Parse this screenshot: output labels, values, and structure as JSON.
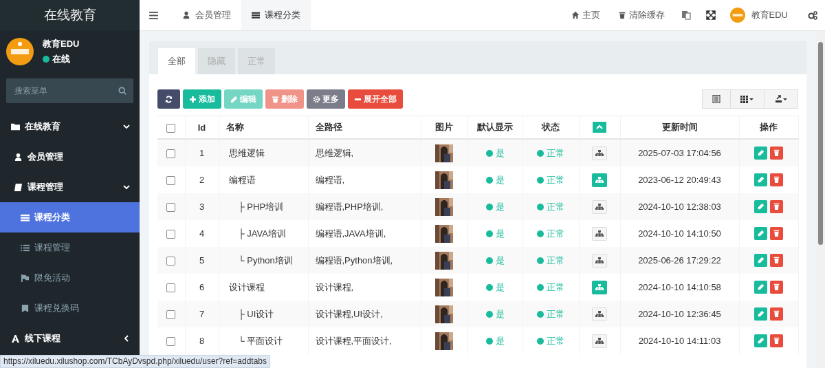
{
  "sidebar": {
    "title": "在线教育",
    "user": {
      "name": "教育EDU",
      "status": "在线"
    },
    "search": {
      "placeholder": "搜索菜单"
    },
    "items": [
      {
        "label": "在线教育",
        "expanded": true,
        "selected": false,
        "children": [
          {
            "label": "会员管理",
            "selected": false
          },
          {
            "label": "课程管理",
            "expanded": true,
            "selected": false,
            "children": [
              {
                "label": "课程分类",
                "selected": true
              },
              {
                "label": "课程管理",
                "selected": false
              },
              {
                "label": "限免活动",
                "selected": false
              },
              {
                "label": "课程兑换码",
                "selected": false
              }
            ]
          }
        ]
      },
      {
        "label": "线下课程",
        "expanded": false,
        "selected": false
      }
    ]
  },
  "topbar": {
    "tabs": [
      {
        "label": "会员管理",
        "selected": false
      },
      {
        "label": "课程分类",
        "selected": true
      }
    ],
    "links": [
      "主页",
      "清除缓存"
    ],
    "user": "教育EDU"
  },
  "tabs": [
    {
      "label": "全部",
      "selected": true
    },
    {
      "label": "隐藏",
      "selected": false
    },
    {
      "label": "正常",
      "selected": false
    }
  ],
  "toolbar": [
    {
      "kind": "refresh",
      "disabled": false
    },
    {
      "kind": "add",
      "label": "添加",
      "disabled": false
    },
    {
      "kind": "edit",
      "label": "编辑",
      "disabled": true
    },
    {
      "kind": "delete",
      "label": "删除",
      "disabled": true
    },
    {
      "kind": "more",
      "label": "更多",
      "disabled": false
    },
    {
      "kind": "expand",
      "label": "展开全部",
      "disabled": false
    }
  ],
  "table": {
    "all_checked": false,
    "columns": [
      "Id",
      "名称",
      "全路径",
      "图片",
      "默认显示",
      "状态",
      "更新时间",
      "操作"
    ],
    "rows": [
      {
        "id": "1",
        "name": "思维逻辑",
        "path": "思维逻辑,",
        "default_display": "是",
        "status": "正常",
        "updated": "2025-07-03 17:04:56",
        "checked": false
      },
      {
        "id": "2",
        "name": "编程语",
        "path": "编程语,",
        "default_display": "是",
        "status": "正常",
        "updated": "2023-06-12 20:49:43",
        "checked": false,
        "children": [
          {
            "id": "3",
            "name": "├ PHP培训",
            "path": "编程语,PHP培训,",
            "default_display": "是",
            "status": "正常",
            "updated": "2024-10-10 12:38:03",
            "checked": false
          },
          {
            "id": "4",
            "name": "├ JAVA培训",
            "path": "编程语,JAVA培训,",
            "default_display": "是",
            "status": "正常",
            "updated": "2024-10-10 14:10:50",
            "checked": false
          },
          {
            "id": "5",
            "name": "└ Python培训",
            "path": "编程语,Python培训,",
            "default_display": "是",
            "status": "正常",
            "updated": "2025-06-26 17:29:22",
            "checked": false
          }
        ]
      },
      {
        "id": "6",
        "name": "设计课程",
        "path": "设计课程,",
        "default_display": "是",
        "status": "正常",
        "updated": "2024-10-10 14:10:58",
        "checked": false,
        "children": [
          {
            "id": "7",
            "name": "├ UI设计",
            "path": "设计课程,UI设计,",
            "default_display": "是",
            "status": "正常",
            "updated": "2024-10-10 12:36:45",
            "checked": false
          },
          {
            "id": "8",
            "name": "└ 平面设计",
            "path": "设计课程,平面设计,",
            "default_display": "是",
            "status": "正常",
            "updated": "2024-10-10 14:11:03",
            "checked": false
          }
        ]
      }
    ]
  },
  "status_url": "https://xiluedu.xilushop.com/TCbAyDvspd.php/xiluedu/user?ref=addtabs"
}
